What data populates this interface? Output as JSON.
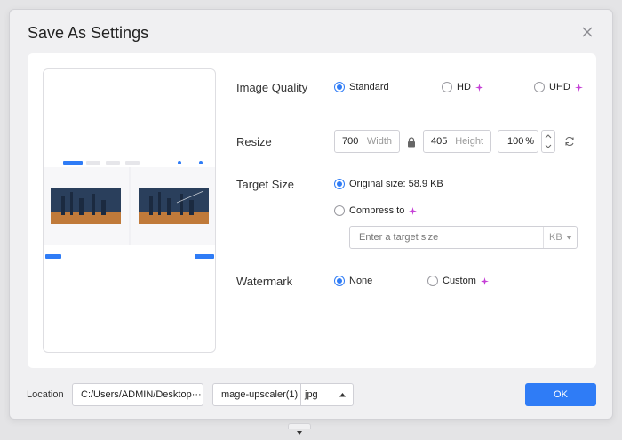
{
  "dialog": {
    "title": "Save As Settings"
  },
  "image_quality": {
    "label": "Image Quality",
    "options": [
      {
        "label": "Standard",
        "selected": true
      },
      {
        "label": "HD",
        "premium": true
      },
      {
        "label": "UHD",
        "premium": true
      }
    ]
  },
  "resize": {
    "label": "Resize",
    "width_value": "700",
    "width_label": "Width",
    "height_value": "405",
    "height_label": "Height",
    "percent_value": "100",
    "percent_unit": "%"
  },
  "target_size": {
    "label": "Target Size",
    "original_label": "Original size: 58.9 KB",
    "compress_label": "Compress to",
    "input_placeholder": "Enter a target size",
    "unit": "KB"
  },
  "watermark": {
    "label": "Watermark",
    "options": [
      {
        "label": "None",
        "selected": true
      },
      {
        "label": "Custom",
        "premium": true
      }
    ]
  },
  "location": {
    "label": "Location",
    "path": "C:/Users/ADMIN/Desktop",
    "browse_label": "···"
  },
  "file": {
    "name": "mage-upscaler(1)",
    "format": "jpg"
  },
  "ok_label": "OK",
  "colors": {
    "accent": "#2f7cf6",
    "premium": "#c53fd6"
  }
}
